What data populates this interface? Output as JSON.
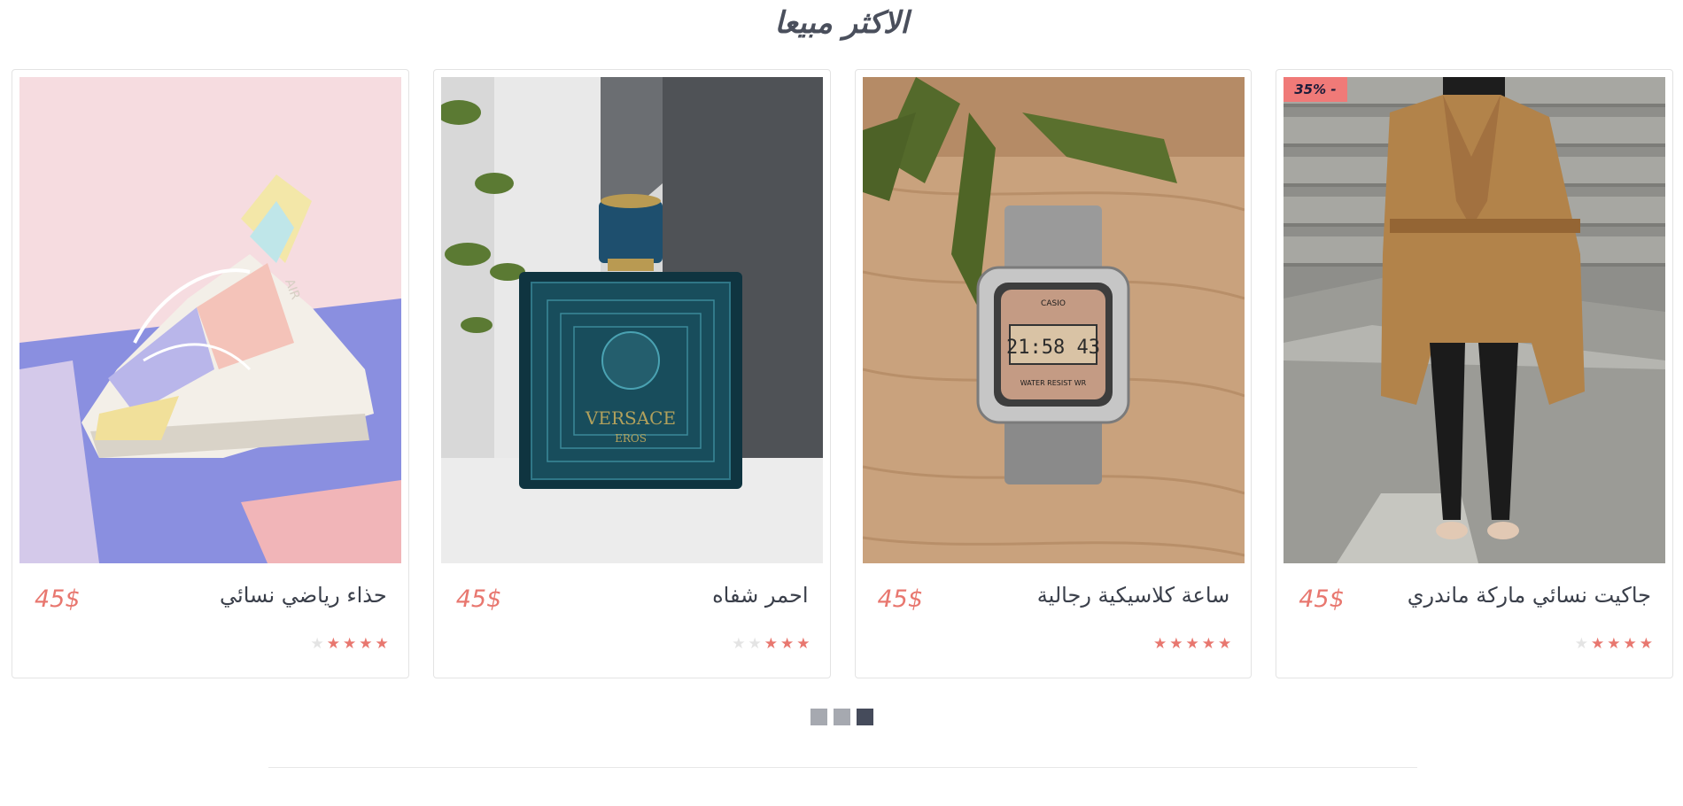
{
  "section": {
    "title": "الاكثر مبيعا"
  },
  "products": [
    {
      "name": "جاكيت نسائي ماركة ماندري",
      "price": "45$",
      "badge": "35% -",
      "rating": 4,
      "max_rating": 5,
      "image_icon": "coat-photo-icon"
    },
    {
      "name": "ساعة كلاسيكية رجالية",
      "price": "45$",
      "badge": "",
      "rating": 5,
      "max_rating": 5,
      "image_icon": "watch-photo-icon",
      "watch_time": "21:58 43",
      "watch_brand": "CASIO",
      "watch_label": "WATER RESIST WR"
    },
    {
      "name": "احمر شفاه",
      "price": "45$",
      "badge": "",
      "rating": 3,
      "max_rating": 5,
      "image_icon": "perfume-photo-icon",
      "perfume_brand": "VERSACE",
      "perfume_line": "EROS"
    },
    {
      "name": "حذاء رياضي نسائي",
      "price": "45$",
      "badge": "",
      "rating": 4,
      "max_rating": 5,
      "image_icon": "sneaker-photo-icon",
      "sneaker_text": "AIR"
    }
  ],
  "pager": {
    "count": 3,
    "active_index": 2
  },
  "colors": {
    "accent": "#e8776f",
    "title": "#4a4f5c",
    "dot_inactive": "#a6a9b0",
    "dot_active": "#454b5b",
    "star_empty": "#e4e4e4"
  }
}
